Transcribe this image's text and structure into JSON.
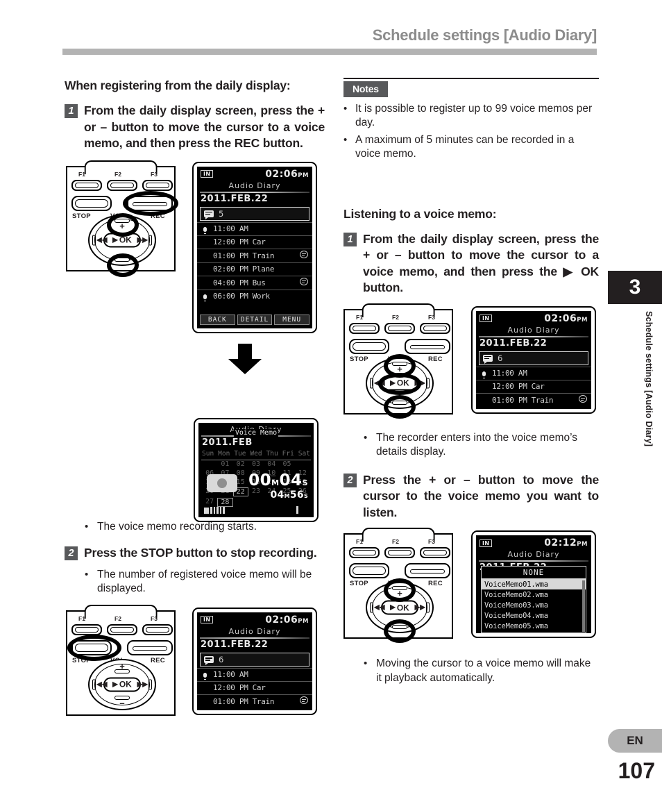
{
  "header": {
    "title": "Schedule settings [Audio Diary]"
  },
  "sidebar": {
    "chapter_number": "3",
    "chapter_title": "Schedule settings [Audio Diary]",
    "language_badge": "EN",
    "page_number": "107"
  },
  "left_column": {
    "section_heading": "When registering from the daily display:",
    "step1": {
      "number": "1",
      "text": "From the daily display screen, press the + or – button to move the cursor to a voice memo, and then press the REC button."
    },
    "bullet1": "The voice memo recording starts.",
    "step2": {
      "number": "2",
      "text": "Press the STOP button to stop recording."
    },
    "bullet2": "The number of registered voice memo will be displayed."
  },
  "right_column": {
    "notes": {
      "label": "Notes",
      "items": [
        "It is possible to register up to 99 voice memos per day.",
        "A maximum of 5 minutes can be recorded in a voice memo."
      ]
    },
    "section_heading": "Listening to a voice memo:",
    "step1": {
      "number": "1",
      "text": "From the daily display screen, press the + or – button to move the cursor to a voice memo, and then press the ▶ OK button."
    },
    "bullet1": "The recorder enters into the voice memo’s details display.",
    "step2": {
      "number": "2",
      "text": "Press the + or – button to move the cursor to the voice memo you want to listen."
    },
    "bullet2": "Moving the cursor to a voice memo will make it playback automatically."
  },
  "device": {
    "function_keys": [
      "F1",
      "F2",
      "F3"
    ],
    "stop_label": "STOP",
    "vol_label": "VOL",
    "rec_label": "REC",
    "ok_label": "OK",
    "plus_label": "+",
    "minus_label": "–"
  },
  "lcd_daily_5": {
    "in_badge": "IN",
    "clock": "02:06",
    "ampm": "PM",
    "title": "Audio Diary",
    "date": "2011.FEB.22",
    "memo_count": "5",
    "events": [
      {
        "mic": true,
        "time": "11:00 AM",
        "name": "",
        "balloon": false
      },
      {
        "mic": false,
        "time": "12:00 PM",
        "name": "Car",
        "balloon": false
      },
      {
        "mic": false,
        "time": "01:00 PM",
        "name": "Train",
        "balloon": true
      },
      {
        "mic": false,
        "time": "02:00 PM",
        "name": "Plane",
        "balloon": false
      },
      {
        "mic": false,
        "time": "04:00 PM",
        "name": "Bus",
        "balloon": true
      },
      {
        "mic": true,
        "time": "06:00 PM",
        "name": "Work",
        "balloon": false
      }
    ],
    "softkeys": [
      "BACK",
      "DETAIL",
      "MENU"
    ]
  },
  "lcd_calendar": {
    "title": "Audio Diary",
    "date": "2011.FEB",
    "weekday_headers": [
      "Sun",
      "Mon",
      "Tue",
      "Wed",
      "Thu",
      "Fri",
      "Sat"
    ],
    "overlay_label": "Voice Memo",
    "days": [
      "",
      "01",
      "02",
      "03",
      "04",
      "05",
      "",
      "06",
      "07",
      "08",
      "09",
      "10",
      "11",
      "12",
      "13",
      "14",
      "15",
      "16",
      "17",
      "18",
      "19",
      "20",
      "21",
      "22",
      "23",
      "24",
      "25",
      "26",
      "27",
      "28",
      "",
      "",
      "",
      "",
      ""
    ],
    "selected_day": "22",
    "underlined_day": "10",
    "today_day": "28",
    "elapsed_time": "00м04s",
    "elapsed_min": "00",
    "elapsed_min_unit": "M",
    "elapsed_sec": "04",
    "elapsed_sec_unit": "S",
    "remain_min": "04",
    "remain_min_unit": "M",
    "remain_sec": "56",
    "remain_sec_unit": "S"
  },
  "lcd_daily_6": {
    "in_badge": "IN",
    "clock": "02:06",
    "ampm": "PM",
    "title": "Audio Diary",
    "date": "2011.FEB.22",
    "memo_count": "6",
    "events": [
      {
        "mic": true,
        "time": "11:00 AM",
        "name": "",
        "balloon": false
      },
      {
        "mic": false,
        "time": "12:00 PM",
        "name": "Car",
        "balloon": false
      },
      {
        "mic": false,
        "time": "01:00 PM",
        "name": "Train",
        "balloon": true
      }
    ]
  },
  "lcd_filelist": {
    "in_badge": "IN",
    "clock": "02:12",
    "ampm": "PM",
    "title": "Audio Diary",
    "date": "2011.FEB.22",
    "popup_title": "NONE",
    "files": [
      "VoiceMemo01.wma",
      "VoiceMemo02.wma",
      "VoiceMemo03.wma",
      "VoiceMemo04.wma",
      "VoiceMemo05.wma"
    ],
    "selected_file": "VoiceMemo01.wma"
  }
}
